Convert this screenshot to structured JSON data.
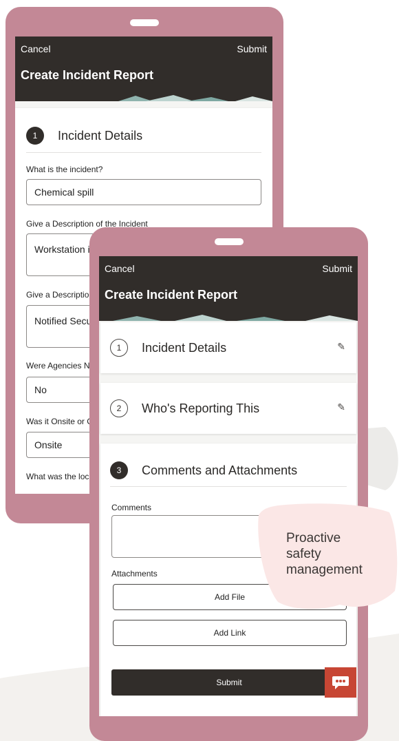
{
  "app": {
    "cancel_label": "Cancel",
    "submit_label": "Submit",
    "title": "Create Incident Report"
  },
  "phone_back": {
    "step": {
      "number": "1",
      "label": "Incident Details"
    },
    "fields": [
      {
        "label": "What is the incident?",
        "value": "Chemical spill"
      },
      {
        "label": "Give a Description of the Incident",
        "value": "Workstation i"
      },
      {
        "label": "Give a Descriptio",
        "value": "Notified Secu"
      },
      {
        "label": "Were Agencies N",
        "value": "No"
      },
      {
        "label": "Was it Onsite or C",
        "value": "Onsite"
      },
      {
        "label": "What was the loc",
        "value": ""
      }
    ]
  },
  "phone_front": {
    "steps": [
      {
        "number": "1",
        "label": "Incident Details",
        "state": "completed"
      },
      {
        "number": "2",
        "label": "Who's Reporting This",
        "state": "completed"
      },
      {
        "number": "3",
        "label": "Comments and Attachments",
        "state": "active"
      }
    ],
    "comments_label": "Comments",
    "comments_value": "",
    "attachments_label": "Attachments",
    "add_file_label": "Add File",
    "add_link_label": "Add Link",
    "submit_button_label": "Submit",
    "chat_icon": "chat-bubble-ellipsis-icon"
  },
  "callout": {
    "line1": "Proactive",
    "line2": "safety",
    "line3": "management"
  },
  "colors": {
    "device_frame": "#c38896",
    "app_bar": "#312d2a",
    "chat_button": "#c74634",
    "callout_bubble": "#fbe7e6",
    "page_swoosh": "#f3f1ee"
  }
}
